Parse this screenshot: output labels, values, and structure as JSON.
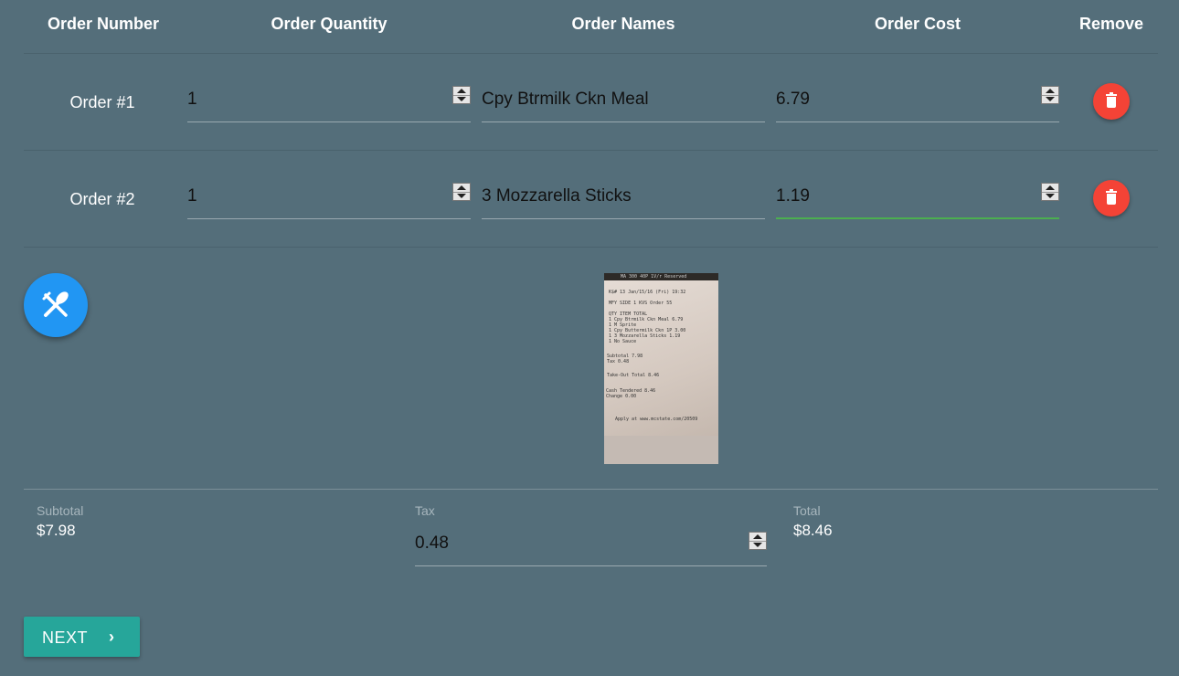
{
  "table": {
    "headers": [
      "Order Number",
      "Order Quantity",
      "Order Names",
      "Order Cost",
      "Remove"
    ],
    "rows": [
      {
        "label": "Order #1",
        "quantity": "1",
        "name": "Cpy Btrmilk Ckn Meal",
        "cost": "6.79"
      },
      {
        "label": "Order #2",
        "quantity": "1",
        "name": "3 Mozzarella Sticks",
        "cost": "1.19"
      }
    ]
  },
  "receipt": {
    "lines": [
      "MA 300 40P 1V/r Reserved",
      "K$# 13        Jan/15/16 (Fri) 19:32",
      "MFY SIDE 1  KVS Order 55",
      "QTY ITEM                 TOTAL",
      " 1 Cpy Btrmilk Ckn Meal   6.79",
      "  1 M Sprite",
      " 1 Cpy Buttermilk Ckn   1P  3.00",
      " 1 3 Mozzarella Sticks      1.19",
      "  1 No Sauce",
      "Subtotal                   7.98",
      "  Tax                      0.48",
      "Take-Out Total             8.46",
      "Cash Tendered              8.46",
      "Change                     0.00",
      "Apply at www.mcstate.com/20509"
    ]
  },
  "summary": {
    "subtotal_label": "Subtotal",
    "subtotal_value": "$7.98",
    "tax_label": "Tax",
    "tax_value": "0.48",
    "total_label": "Total",
    "total_value": "$8.46"
  },
  "actions": {
    "next_label": "NEXT",
    "next_icon": "chevron-right-icon",
    "fab_icon": "utensils-icon",
    "remove_icon": "trash-icon"
  },
  "colors": {
    "background": "#546e7a",
    "remove": "#f44336",
    "fab": "#2196f3",
    "next": "#26a69a",
    "active_underline": "#4caf50"
  }
}
